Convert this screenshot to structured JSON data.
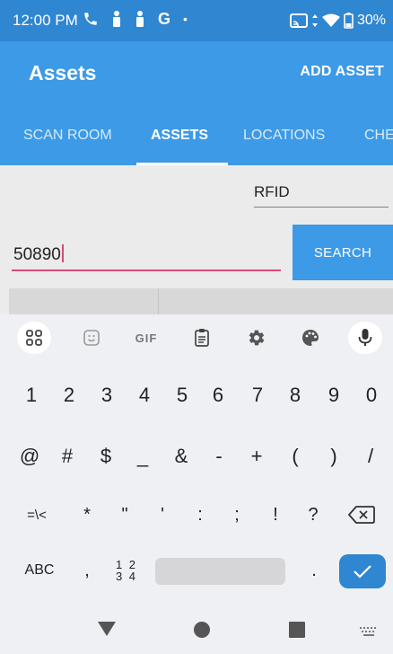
{
  "status_bar": {
    "time": "12:00 PM",
    "left_icons": [
      "phone-icon",
      "person-icon",
      "person-icon",
      "google-icon",
      "dot-icon"
    ],
    "right_icons": [
      "cast-icon",
      "data-arrows-icon",
      "wifi-icon",
      "battery-icon"
    ],
    "g_letter": "G",
    "dot": "•",
    "battery": "30%"
  },
  "app_bar": {
    "title": "Assets",
    "action": "ADD ASSET"
  },
  "tabs": [
    {
      "label": "SCAN ROOM",
      "active": false
    },
    {
      "label": "ASSETS",
      "active": true
    },
    {
      "label": "LOCATIONS",
      "active": false
    },
    {
      "label": "CHE",
      "active": false
    }
  ],
  "form": {
    "rfid_label": "RFID",
    "search_value": "50890",
    "search_button": "SEARCH"
  },
  "keyboard": {
    "toolbar": [
      "apps-grid-icon",
      "sticker-icon",
      "GIF",
      "clipboard-icon",
      "settings-icon",
      "palette-icon",
      "mic-icon"
    ],
    "row1": [
      "1",
      "2",
      "3",
      "4",
      "5",
      "6",
      "7",
      "8",
      "9",
      "0"
    ],
    "row2": [
      "@",
      "#",
      "$",
      "_",
      "&",
      "-",
      "+",
      "(",
      ")",
      "/"
    ],
    "row3": [
      "=\\<",
      "*",
      "\"",
      "'",
      ":",
      ";",
      "!",
      "?",
      "⌫"
    ],
    "bottom": {
      "abc": "ABC",
      "comma": ",",
      "fraction_top": "1 2",
      "fraction_bottom": "3 4",
      "period": ".",
      "enter": "✓"
    }
  },
  "nav_bar": {
    "buttons": [
      "back-icon",
      "home-icon",
      "recents-icon",
      "keyboard-switch-icon"
    ]
  },
  "colors": {
    "status_bar": "#2f86d1",
    "primary": "#3d9ae6",
    "accent_underline": "#d24c7a",
    "enter_key": "#2f86d1"
  }
}
